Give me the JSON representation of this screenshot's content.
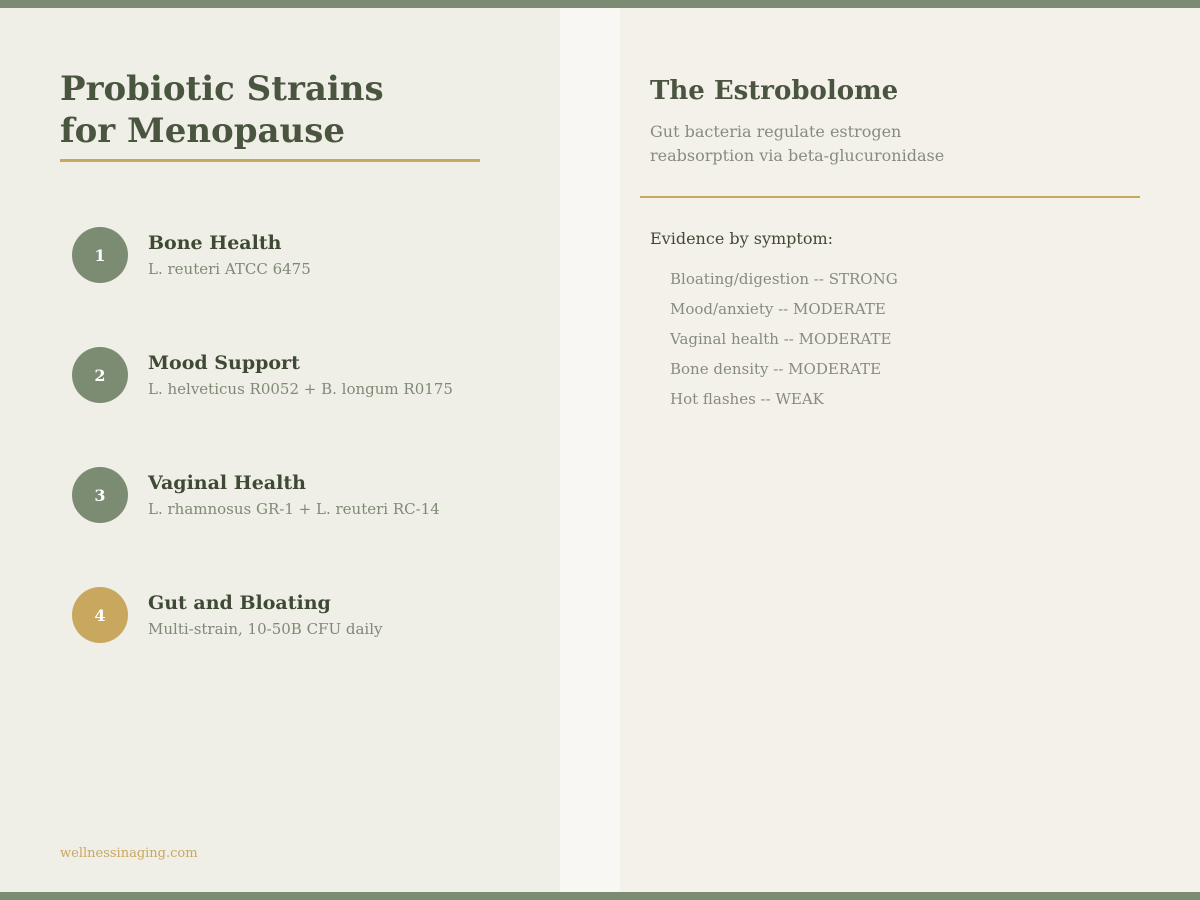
{
  "colors": {
    "sage": "#7b8c72",
    "gold": "#c8a75f",
    "heading": "#4a5540",
    "muted": "#868c7d",
    "left_bg": "#efeee7",
    "right_bg": "#f4f1ea"
  },
  "left": {
    "title": "Probiotic Strains\nfor Menopause",
    "strains": [
      {
        "number": "1",
        "title": "Bone Health",
        "subtitle": "L. reuteri ATCC 6475",
        "badge_color": "#7b8c72"
      },
      {
        "number": "2",
        "title": "Mood Support",
        "subtitle": "L. helveticus R0052 + B. longum R0175",
        "badge_color": "#7b8c72"
      },
      {
        "number": "3",
        "title": "Vaginal Health",
        "subtitle": "L. rhamnosus GR-1 + L. reuteri RC-14",
        "badge_color": "#7b8c72"
      },
      {
        "number": "4",
        "title": "Gut and Bloating",
        "subtitle": "Multi-strain, 10-50B CFU daily",
        "badge_color": "#c8a75f"
      }
    ],
    "footer_url": "wellnessinaging.com"
  },
  "right": {
    "title": "The Estrobolome",
    "subtitle": "Gut bacteria regulate estrogen\nreabsorption via beta-glucuronidase",
    "evidence_heading": "Evidence by symptom:",
    "evidence": [
      "Bloating/digestion -- STRONG",
      "Mood/anxiety -- MODERATE",
      "Vaginal health -- MODERATE",
      "Bone density -- MODERATE",
      "Hot flashes -- WEAK"
    ]
  }
}
